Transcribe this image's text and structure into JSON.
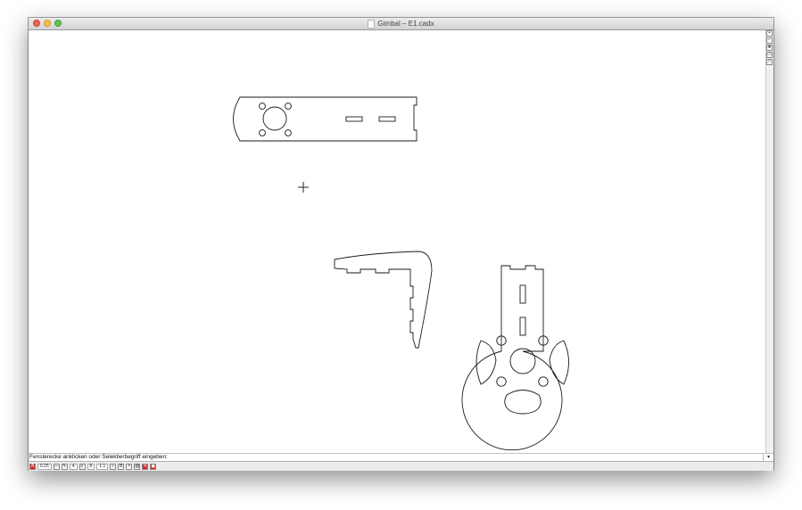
{
  "window": {
    "title": "Gimbal – E1.cadx"
  },
  "command_line": {
    "prompt": "Fensterecke anklicken oder Selektierbegriff eingeben:",
    "dropdown_icon": "chevron-down-icon"
  },
  "statusbar": {
    "line_width": "0.25",
    "layer": "4",
    "field2": "8",
    "scale": "1:1"
  },
  "vertical_toolbar": [
    "zoom-in-icon",
    "zoom-out-icon",
    "pan-icon",
    "zoom-window-icon",
    "zoom-all-icon"
  ],
  "colors": {
    "accent_red": "#d62b2b",
    "line": "#1a1a1a"
  }
}
